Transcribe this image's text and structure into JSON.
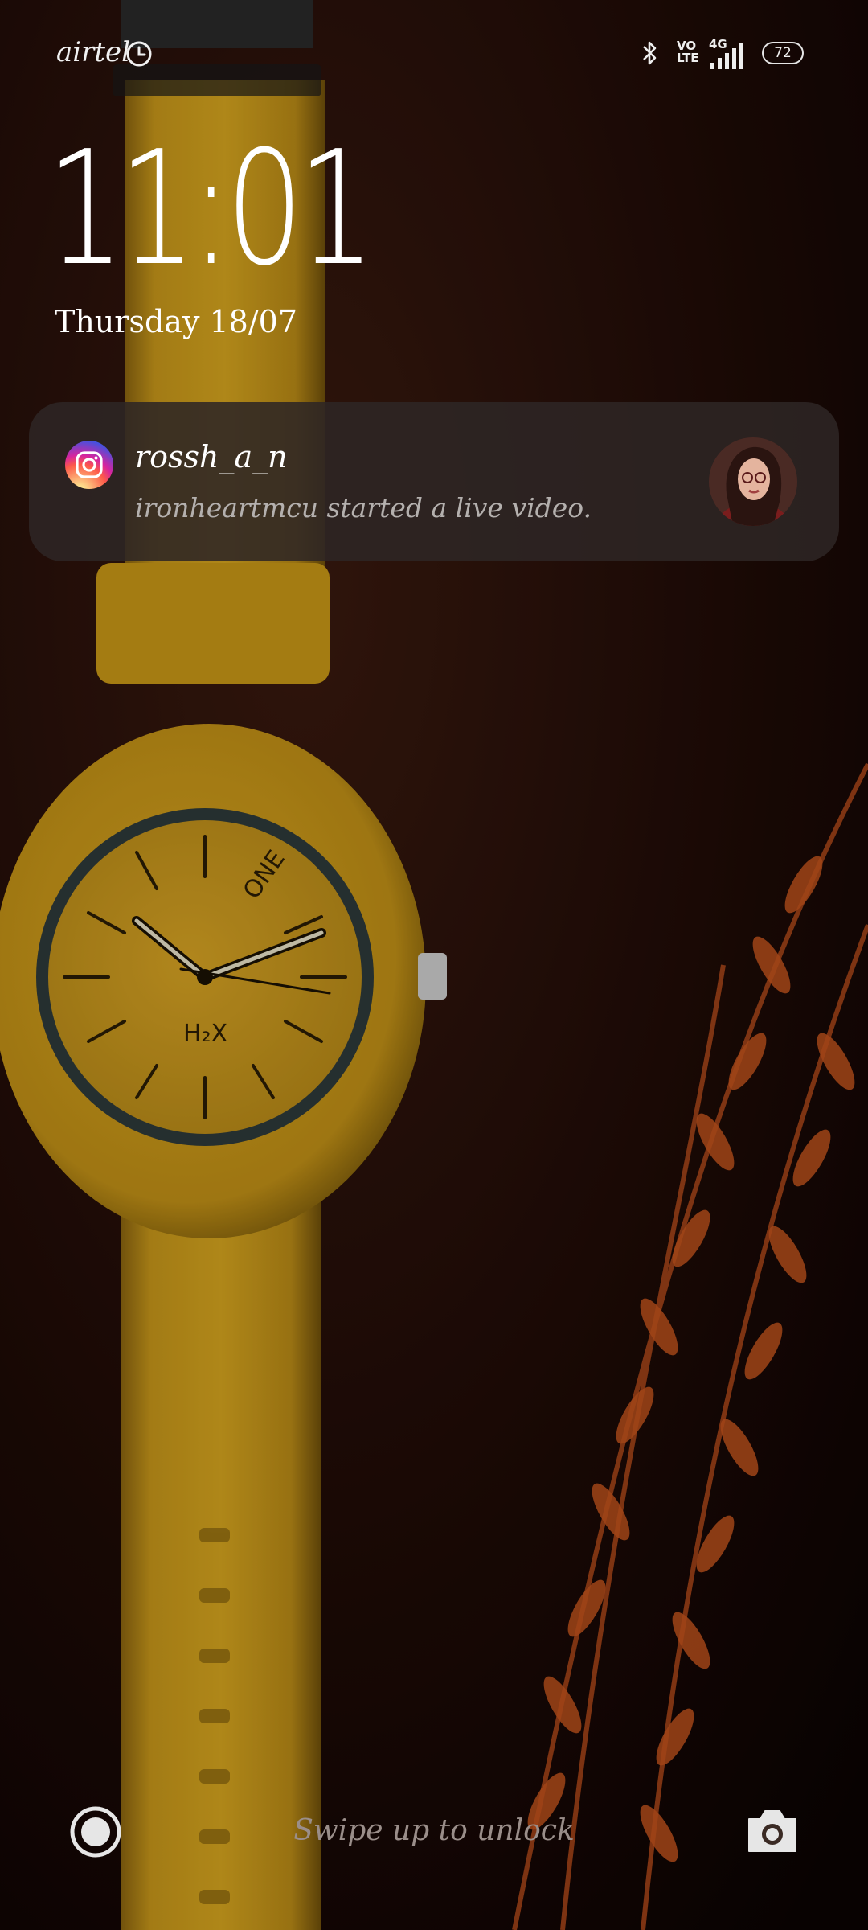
{
  "status_bar": {
    "carrier": "airtel",
    "volte_label": "VoLTE",
    "network_type": "4G",
    "battery_percent": "72",
    "icons": [
      "alarm-clock-icon",
      "bluetooth-icon",
      "signal-icon",
      "battery-icon"
    ]
  },
  "lock_screen": {
    "time": "11:01",
    "date": "Thursday 18/07"
  },
  "notification": {
    "app_icon": "instagram-icon",
    "title": "rossh_a_n",
    "body": "ironheartmcu started a live video.",
    "avatar_icon": "profile-avatar"
  },
  "bottom": {
    "left_icon": "shortcut-ring-icon",
    "swipe_hint": "Swipe up to unlock",
    "right_icon": "camera-icon"
  },
  "colors": {
    "watch_yellow": "#d9a41c",
    "background_dark": "#1a0806",
    "plant_orange": "#c4541e"
  }
}
